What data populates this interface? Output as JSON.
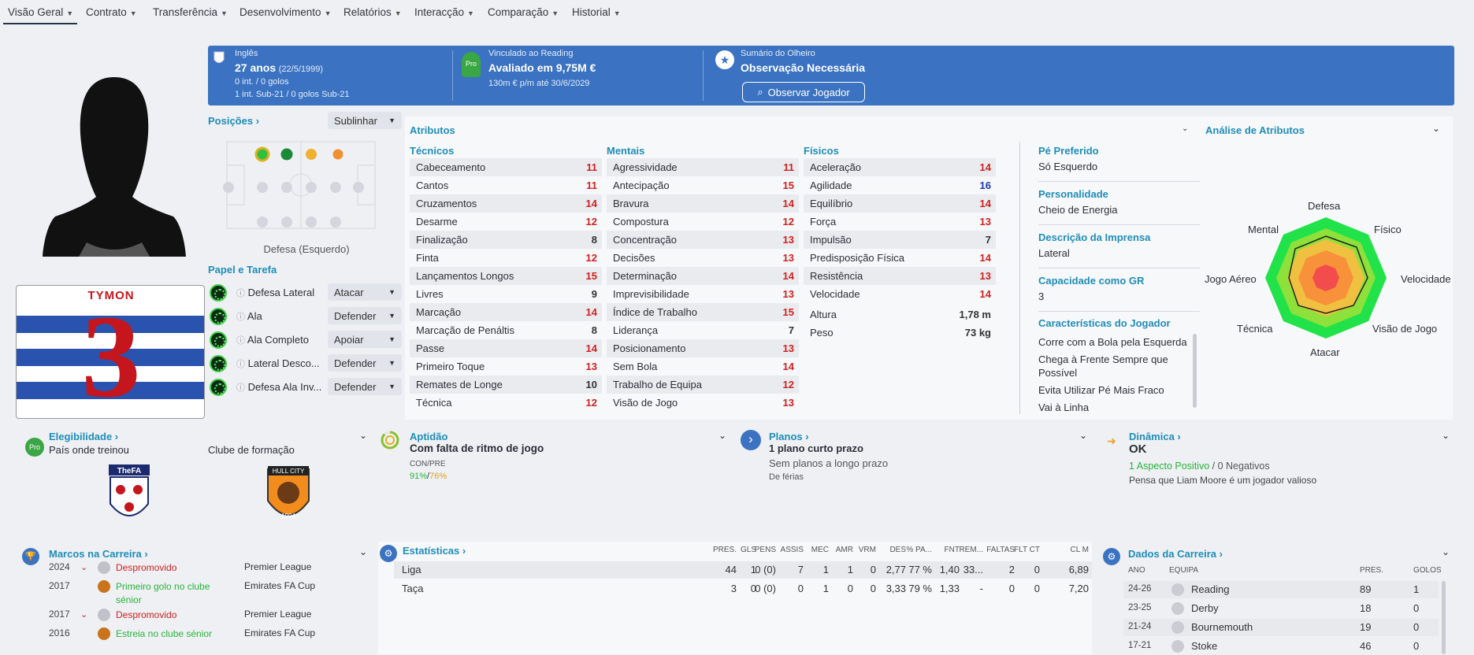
{
  "nav": {
    "items": [
      "Visão Geral",
      "Contrato",
      "Transferência",
      "Desenvolvimento",
      "Relatórios",
      "Interacção",
      "Comparação",
      "Historial"
    ]
  },
  "header": {
    "nationality": "Inglês",
    "age": "27 anos",
    "dob": "(22/5/1999)",
    "caps": "0 int. / 0 golos",
    "u21": "1 int. Sub-21 / 0 golos Sub-21",
    "club_label": "Vinculado ao Reading",
    "value": "Avaliado em 9,75M €",
    "wage": "130m € p/m até 30/6/2029",
    "scout_label": "Sumário do Olheiro",
    "scout_value": "Observação Necessária",
    "scout_button": "Observar Jogador",
    "badge": "Pro"
  },
  "kit": {
    "name": "TYMON",
    "number": "3"
  },
  "positions": {
    "title": "Posições",
    "highlight": "Sublinhar",
    "caption": "Defesa (Esquerdo)"
  },
  "roles": {
    "title": "Papel e Tarefa",
    "items": [
      {
        "name": "Defesa Lateral",
        "duty": "Atacar"
      },
      {
        "name": "Ala",
        "duty": "Defender"
      },
      {
        "name": "Ala Completo",
        "duty": "Apoiar"
      },
      {
        "name": "Lateral Desco...",
        "duty": "Defender"
      },
      {
        "name": "Defesa Ala Inv...",
        "duty": "Defender"
      }
    ]
  },
  "attributes": {
    "title": "Atributos",
    "technical_title": "Técnicos",
    "mental_title": "Mentais",
    "physical_title": "Físicos",
    "technical": [
      {
        "name": "Cabeceamento",
        "value": "11",
        "c": "r"
      },
      {
        "name": "Cantos",
        "value": "11",
        "c": "r"
      },
      {
        "name": "Cruzamentos",
        "value": "14",
        "c": "r"
      },
      {
        "name": "Desarme",
        "value": "12",
        "c": "r"
      },
      {
        "name": "Finalização",
        "value": "8",
        "c": "k"
      },
      {
        "name": "Finta",
        "value": "12",
        "c": "r"
      },
      {
        "name": "Lançamentos Longos",
        "value": "15",
        "c": "r"
      },
      {
        "name": "Livres",
        "value": "9",
        "c": "k"
      },
      {
        "name": "Marcação",
        "value": "14",
        "c": "r"
      },
      {
        "name": "Marcação de Penáltis",
        "value": "8",
        "c": "k"
      },
      {
        "name": "Passe",
        "value": "14",
        "c": "r"
      },
      {
        "name": "Primeiro Toque",
        "value": "13",
        "c": "r"
      },
      {
        "name": "Remates de Longe",
        "value": "10",
        "c": "k"
      },
      {
        "name": "Técnica",
        "value": "12",
        "c": "r"
      }
    ],
    "mental": [
      {
        "name": "Agressividade",
        "value": "11",
        "c": "r"
      },
      {
        "name": "Antecipação",
        "value": "15",
        "c": "r"
      },
      {
        "name": "Bravura",
        "value": "14",
        "c": "r"
      },
      {
        "name": "Compostura",
        "value": "12",
        "c": "r"
      },
      {
        "name": "Concentração",
        "value": "13",
        "c": "r"
      },
      {
        "name": "Decisões",
        "value": "13",
        "c": "r"
      },
      {
        "name": "Determinação",
        "value": "14",
        "c": "r"
      },
      {
        "name": "Imprevisibilidade",
        "value": "13",
        "c": "r"
      },
      {
        "name": "Índice de Trabalho",
        "value": "15",
        "c": "r"
      },
      {
        "name": "Liderança",
        "value": "7",
        "c": "k"
      },
      {
        "name": "Posicionamento",
        "value": "13",
        "c": "r"
      },
      {
        "name": "Sem Bola",
        "value": "14",
        "c": "r"
      },
      {
        "name": "Trabalho de Equipa",
        "value": "12",
        "c": "r"
      },
      {
        "name": "Visão de Jogo",
        "value": "13",
        "c": "r"
      }
    ],
    "physical": [
      {
        "name": "Aceleração",
        "value": "14",
        "c": "r"
      },
      {
        "name": "Agilidade",
        "value": "16",
        "c": "b"
      },
      {
        "name": "Equilíbrio",
        "value": "14",
        "c": "r"
      },
      {
        "name": "Força",
        "value": "13",
        "c": "r"
      },
      {
        "name": "Impulsão",
        "value": "7",
        "c": "k"
      },
      {
        "name": "Predisposição Física",
        "value": "14",
        "c": "r"
      },
      {
        "name": "Resistência",
        "value": "13",
        "c": "r"
      },
      {
        "name": "Velocidade",
        "value": "14",
        "c": "r"
      }
    ],
    "height_label": "Altura",
    "height": "1,78 m",
    "weight_label": "Peso",
    "weight": "73 kg"
  },
  "info": {
    "foot_label": "Pé Preferido",
    "foot": "Só Esquerdo",
    "personality_label": "Personalidade",
    "personality": "Cheio de Energia",
    "press_label": "Descrição da Imprensa",
    "press": "Lateral",
    "gk_label": "Capacidade como GR",
    "gk": "3",
    "traits_label": "Características do Jogador",
    "traits": [
      "Corre com a Bola pela Esquerda",
      "Chega à Frente Sempre que Possível",
      "Evita Utilizar Pé Mais Fraco",
      "Vai à Linha"
    ]
  },
  "analysis": {
    "title": "Análise de Atributos",
    "labels": [
      "Defesa",
      "Físico",
      "Velocidade",
      "Visão de Jogo",
      "Atacar",
      "Técnica",
      "Jogo Aéreo",
      "Mental"
    ]
  },
  "eligibility": {
    "title": "Elegibilidade",
    "trained_country": "País onde treinou",
    "trained_club": "Clube de formação",
    "fa_text": "TheFA",
    "hull_text": "HULL CITY",
    "hull_year": "1904"
  },
  "aptitude": {
    "title": "Aptidão",
    "value": "Com falta de ritmo de jogo",
    "sub": "CON/PRE",
    "v1": "91%",
    "v2": "76%"
  },
  "plans": {
    "title": "Planos",
    "value": "1 plano curto prazo",
    "sub": "Sem planos a longo prazo",
    "sub2": "De férias"
  },
  "dynamics": {
    "title": "Dinâmica",
    "value": "OK",
    "pos": "1 Aspecto Positivo",
    "neg": "0 Negativos",
    "note": "Pensa que Liam Moore é um jogador valioso"
  },
  "milestones": {
    "title": "Marcos na Carreira",
    "rows": [
      {
        "year": "2024",
        "text": "Despromovido",
        "comp": "Premier League",
        "c": "r"
      },
      {
        "year": "2017",
        "text": "Primeiro golo no clube sénior",
        "comp": "Emirates FA Cup",
        "c": "g"
      },
      {
        "year": "2017",
        "text": "Despromovido",
        "comp": "Premier League",
        "c": "r"
      },
      {
        "year": "2016",
        "text": "Estreia no clube sénior",
        "comp": "Emirates FA Cup",
        "c": "g"
      }
    ]
  },
  "stats": {
    "title": "Estatísticas",
    "headers": [
      "PRES.",
      "GLS",
      "PENS",
      "ASSIS",
      "MEC",
      "AMR",
      "VRM",
      "DES",
      "% PA...",
      "FNT",
      "REM...",
      "FALTAS",
      "FLT CT",
      "CL M"
    ],
    "rows": [
      {
        "comp": "Liga",
        "vals": [
          "44",
          "1",
          "0 (0)",
          "7",
          "1",
          "1",
          "0",
          "2,77",
          "77 %",
          "1,40",
          "33...",
          "2",
          "0",
          "6,89"
        ]
      },
      {
        "comp": "Taça",
        "vals": [
          "3",
          "0",
          "0 (0)",
          "0",
          "1",
          "0",
          "0",
          "3,33",
          "79 %",
          "1,33",
          "-",
          "0",
          "0",
          "7,20"
        ]
      }
    ]
  },
  "career": {
    "title": "Dados da Carreira",
    "headers": [
      "ANO",
      "EQUIPA",
      "PRES.",
      "GOLOS"
    ],
    "rows": [
      {
        "year": "24-26",
        "team": "Reading",
        "apps": "89",
        "goals": "1"
      },
      {
        "year": "23-25",
        "team": "Derby",
        "apps": "18",
        "goals": "0"
      },
      {
        "year": "21-24",
        "team": "Bournemouth",
        "apps": "19",
        "goals": "0"
      },
      {
        "year": "17-21",
        "team": "Stoke",
        "apps": "46",
        "goals": "0"
      }
    ]
  },
  "colors": {
    "header_blue": "#3b73c2",
    "accent": "#1f8db8",
    "red": "#d02020",
    "green": "#27b43a"
  }
}
